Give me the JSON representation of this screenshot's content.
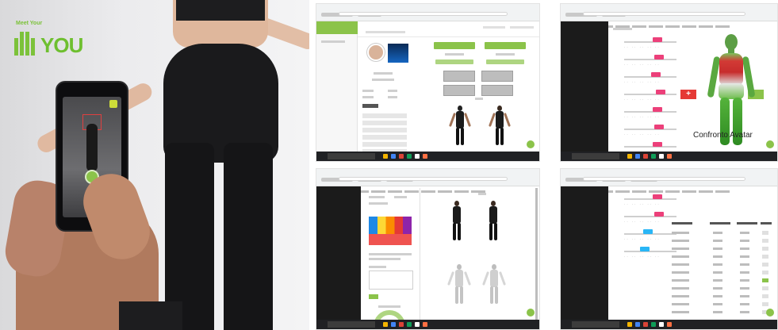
{
  "photo": {
    "logo_small": "Meet Your",
    "logo_text": "YOU",
    "brand_color": "#6ebf2f"
  },
  "shot_avatar": {
    "red_button_symbol": "+",
    "caption": "Confronto Avatar"
  },
  "colors": {
    "accent_green": "#8bc34a",
    "alert_red": "#e53935",
    "slider_pink": "#ec407a",
    "slider_blue": "#29b6f6",
    "taskbar": "#202124"
  },
  "icons": {
    "logo": "body-silhouette-icon",
    "shutter": "camera-shutter-icon",
    "add": "plus-icon",
    "fab": "chat-bubble-icon"
  }
}
